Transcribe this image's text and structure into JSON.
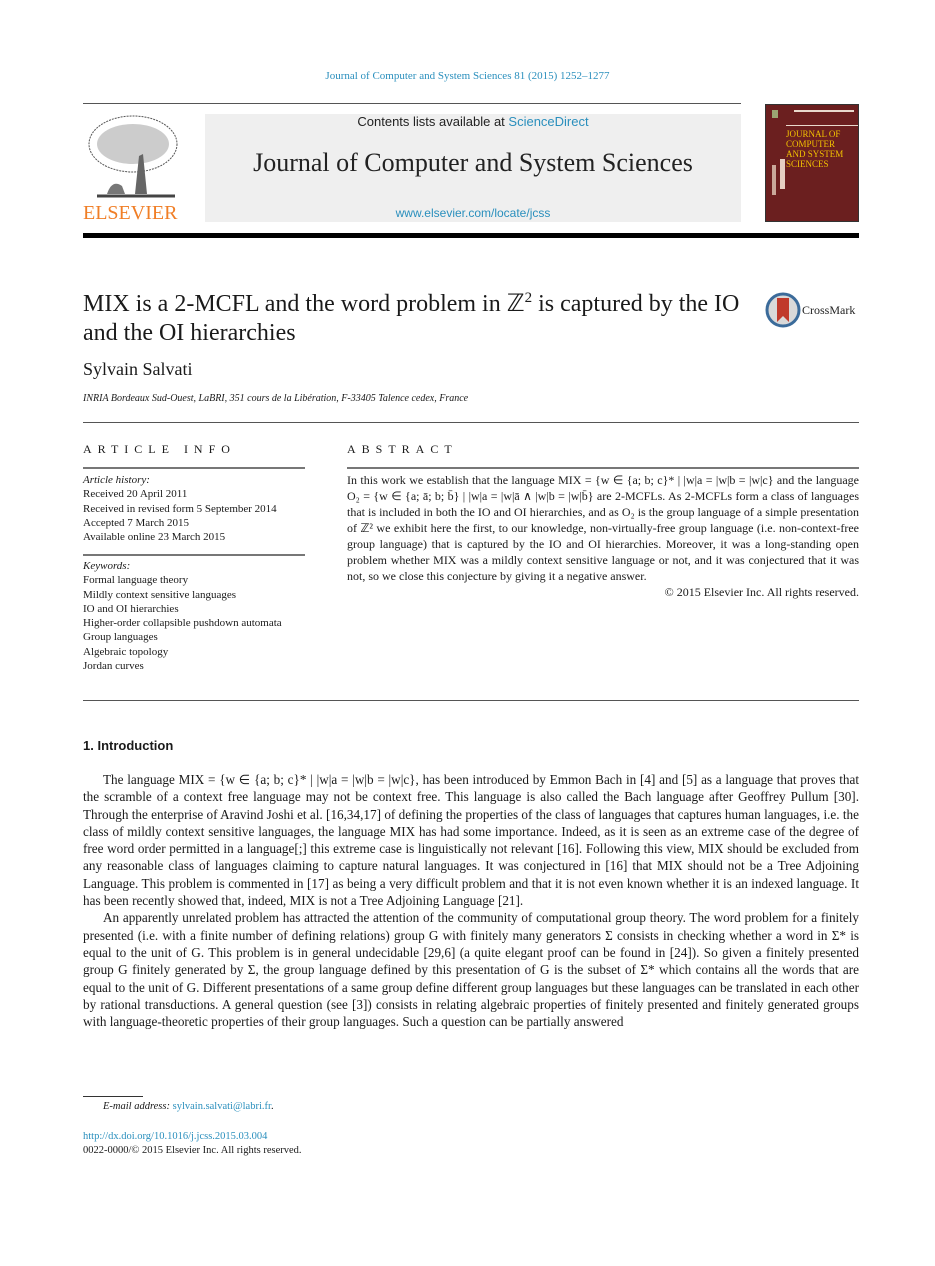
{
  "running_head": "Journal of Computer and System Sciences 81 (2015) 1252–1277",
  "publisher": {
    "name": "ELSEVIER",
    "logo_icon": "elsevier-tree-logo",
    "color": "#f07e26"
  },
  "banner": {
    "contents_prefix": "Contents lists available at ",
    "contents_link": "ScienceDirect",
    "journal_title": "Journal of Computer and System Sciences",
    "journal_url": "www.elsevier.com/locate/jcss"
  },
  "cover": {
    "lines": [
      "JOURNAL OF",
      "COMPUTER",
      "AND SYSTEM",
      "SCIENCES"
    ],
    "color": "#6b1f1f"
  },
  "article": {
    "title_part1": "MIX is a 2-MCFL and the word problem in ℤ",
    "title_sup": "2",
    "title_part2": " is captured by the IO and the OI hierarchies",
    "author": "Sylvain Salvati",
    "affiliation": "INRIA Bordeaux Sud-Ouest, LaBRI, 351 cours de la Libération, F-33405 Talence cedex, France",
    "crossmark_label": "CrossMark"
  },
  "article_info": {
    "header": "ARTICLE  INFO",
    "history_label": "Article history:",
    "history": [
      "Received 20 April 2011",
      "Received in revised form 5 September 2014",
      "Accepted 7 March 2015",
      "Available online 23 March 2015"
    ],
    "keywords_label": "Keywords:",
    "keywords": [
      "Formal language theory",
      "Mildly context sensitive languages",
      "IO and OI hierarchies",
      "Higher-order collapsible pushdown automata",
      "Group languages",
      "Algebraic topology",
      "Jordan curves"
    ]
  },
  "abstract": {
    "header": "ABSTRACT",
    "text": "In this work we establish that the language MIX = {w ∈ {a; b; c}* | |w|a = |w|b = |w|c} and the language O₂ = {w ∈ {a; ā; b; b̄} | |w|a = |w|ā ∧ |w|b = |w|b̄} are 2-MCFLs. As 2-MCFLs form a class of languages that is included in both the IO and OI hierarchies, and as O₂ is the group language of a simple presentation of ℤ² we exhibit here the first, to our knowledge, non-virtually-free group language (i.e. non-context-free group language) that is captured by the IO and OI hierarchies. Moreover, it was a long-standing open problem whether MIX was a mildly context sensitive language or not, and it was conjectured that it was not, so we close this conjecture by giving it a negative answer.",
    "copyright": "© 2015 Elsevier Inc. All rights reserved."
  },
  "section": {
    "heading": "1. Introduction",
    "paragraphs": [
      "The language MIX = {w ∈ {a; b; c}* | |w|a = |w|b = |w|c}, has been introduced by Emmon Bach in [4] and [5] as a language that proves that the scramble of a context free language may not be context free. This language is also called the Bach language after Geoffrey Pullum [30]. Through the enterprise of Aravind Joshi et al. [16,34,17] of defining the properties of the class of languages that captures human languages, i.e. the class of mildly context sensitive languages, the language MIX has had some importance. Indeed, as it is seen as an extreme case of the degree of free word order permitted in a language[;] this extreme case is linguistically not relevant [16]. Following this view, MIX should be excluded from any reasonable class of languages claiming to capture natural languages. It was conjectured in [16] that MIX should not be a Tree Adjoining Language. This problem is commented in [17] as being a very difficult problem and that it is not even known whether it is an indexed language. It has been recently showed that, indeed, MIX is not a Tree Adjoining Language [21].",
      "An apparently unrelated problem has attracted the attention of the community of computational group theory. The word problem for a finitely presented (i.e. with a finite number of defining relations) group G with finitely many generators Σ consists in checking whether a word in Σ* is equal to the unit of G. This problem is in general undecidable [29,6] (a quite elegant proof can be found in [24]). So given a finitely presented group G finitely generated by Σ, the group language defined by this presentation of G is the subset of Σ* which contains all the words that are equal to the unit of G. Different presentations of a same group define different group languages but these languages can be translated in each other by rational transductions. A general question (see [3]) consists in relating algebraic properties of finitely presented and finitely generated groups with language-theoretic properties of their group languages. Such a question can be partially answered"
    ]
  },
  "footnote": {
    "label": "E-mail address: ",
    "email": "sylvain.salvati@labri.fr"
  },
  "doi": "http://dx.doi.org/10.1016/j.jcss.2015.03.004",
  "issn_line": "0022-0000/© 2015 Elsevier Inc. All rights reserved."
}
